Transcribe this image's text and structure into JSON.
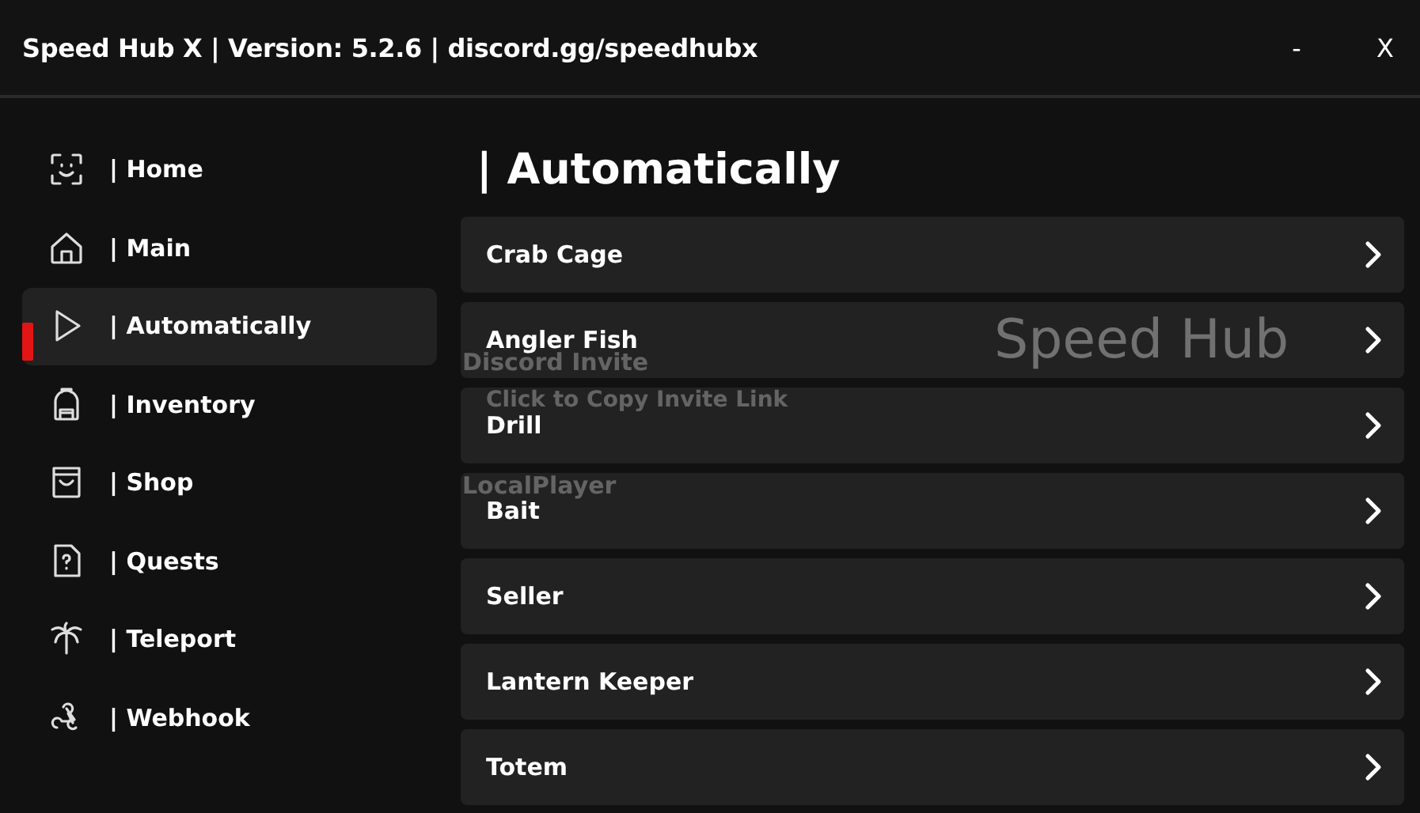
{
  "window": {
    "title": "Speed Hub X | Version: 5.2.6 | discord.gg/speedhubx",
    "minimize": "-",
    "close": "X"
  },
  "sidebar": {
    "items": [
      {
        "label": "| Home",
        "kind": "face",
        "selected": false
      },
      {
        "label": "| Main",
        "kind": "house",
        "selected": false
      },
      {
        "label": "| Automatically",
        "kind": "play",
        "selected": true
      },
      {
        "label": "| Inventory",
        "kind": "backpack",
        "selected": false
      },
      {
        "label": "| Shop",
        "kind": "bag",
        "selected": false
      },
      {
        "label": "| Quests",
        "kind": "question",
        "selected": false
      },
      {
        "label": "| Teleport",
        "kind": "palm",
        "selected": false
      },
      {
        "label": "| Webhook",
        "kind": "webhook",
        "selected": false
      }
    ]
  },
  "content": {
    "heading": "| Automatically",
    "rows": [
      {
        "label": "Crab Cage"
      },
      {
        "label": "Angler Fish"
      },
      {
        "label": "Drill"
      },
      {
        "label": "Bait"
      },
      {
        "label": "Seller"
      },
      {
        "label": "Lantern Keeper"
      },
      {
        "label": "Totem"
      }
    ],
    "faded_behind": [
      "Speed Hub",
      "Discord Invite",
      "Click to Copy Invite Link",
      "LocalPlayer"
    ]
  }
}
